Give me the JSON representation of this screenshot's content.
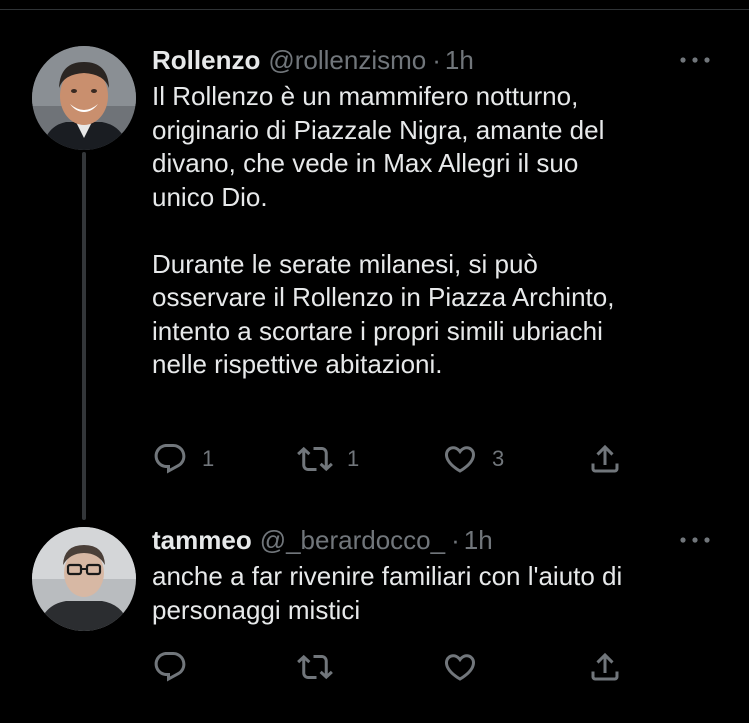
{
  "tweets": [
    {
      "name": "Rollenzo",
      "handle": "@rollenzismo",
      "separator": "·",
      "time": "1h",
      "text": "Il Rollenzo è un mammifero notturno,\noriginario di Piazzale Nigra, amante del\ndivano, che vede in Max Allegri il suo\nunico Dio.\n\nDurante le serate milanesi, si può\nosservare il Rollenzo in Piazza Archinto,\nintento a scortare i propri simili ubriachi\nnelle rispettive abitazioni.",
      "reply_count": "1",
      "retweet_count": "1",
      "like_count": "3"
    },
    {
      "name": "tammeo",
      "handle": "@_berardocco_",
      "separator": "·",
      "time": "1h",
      "text": "anche a far rivenire familiari con l'aiuto di\npersonaggi mistici",
      "reply_count": "",
      "retweet_count": "",
      "like_count": ""
    }
  ],
  "icons": {
    "more": "more-dots-icon",
    "reply": "reply-icon",
    "retweet": "retweet-icon",
    "like": "like-icon",
    "share": "share-icon"
  },
  "colors": {
    "background": "#000000",
    "text": "#e7e9ea",
    "secondary": "#71767b",
    "divider": "#2f3336"
  }
}
